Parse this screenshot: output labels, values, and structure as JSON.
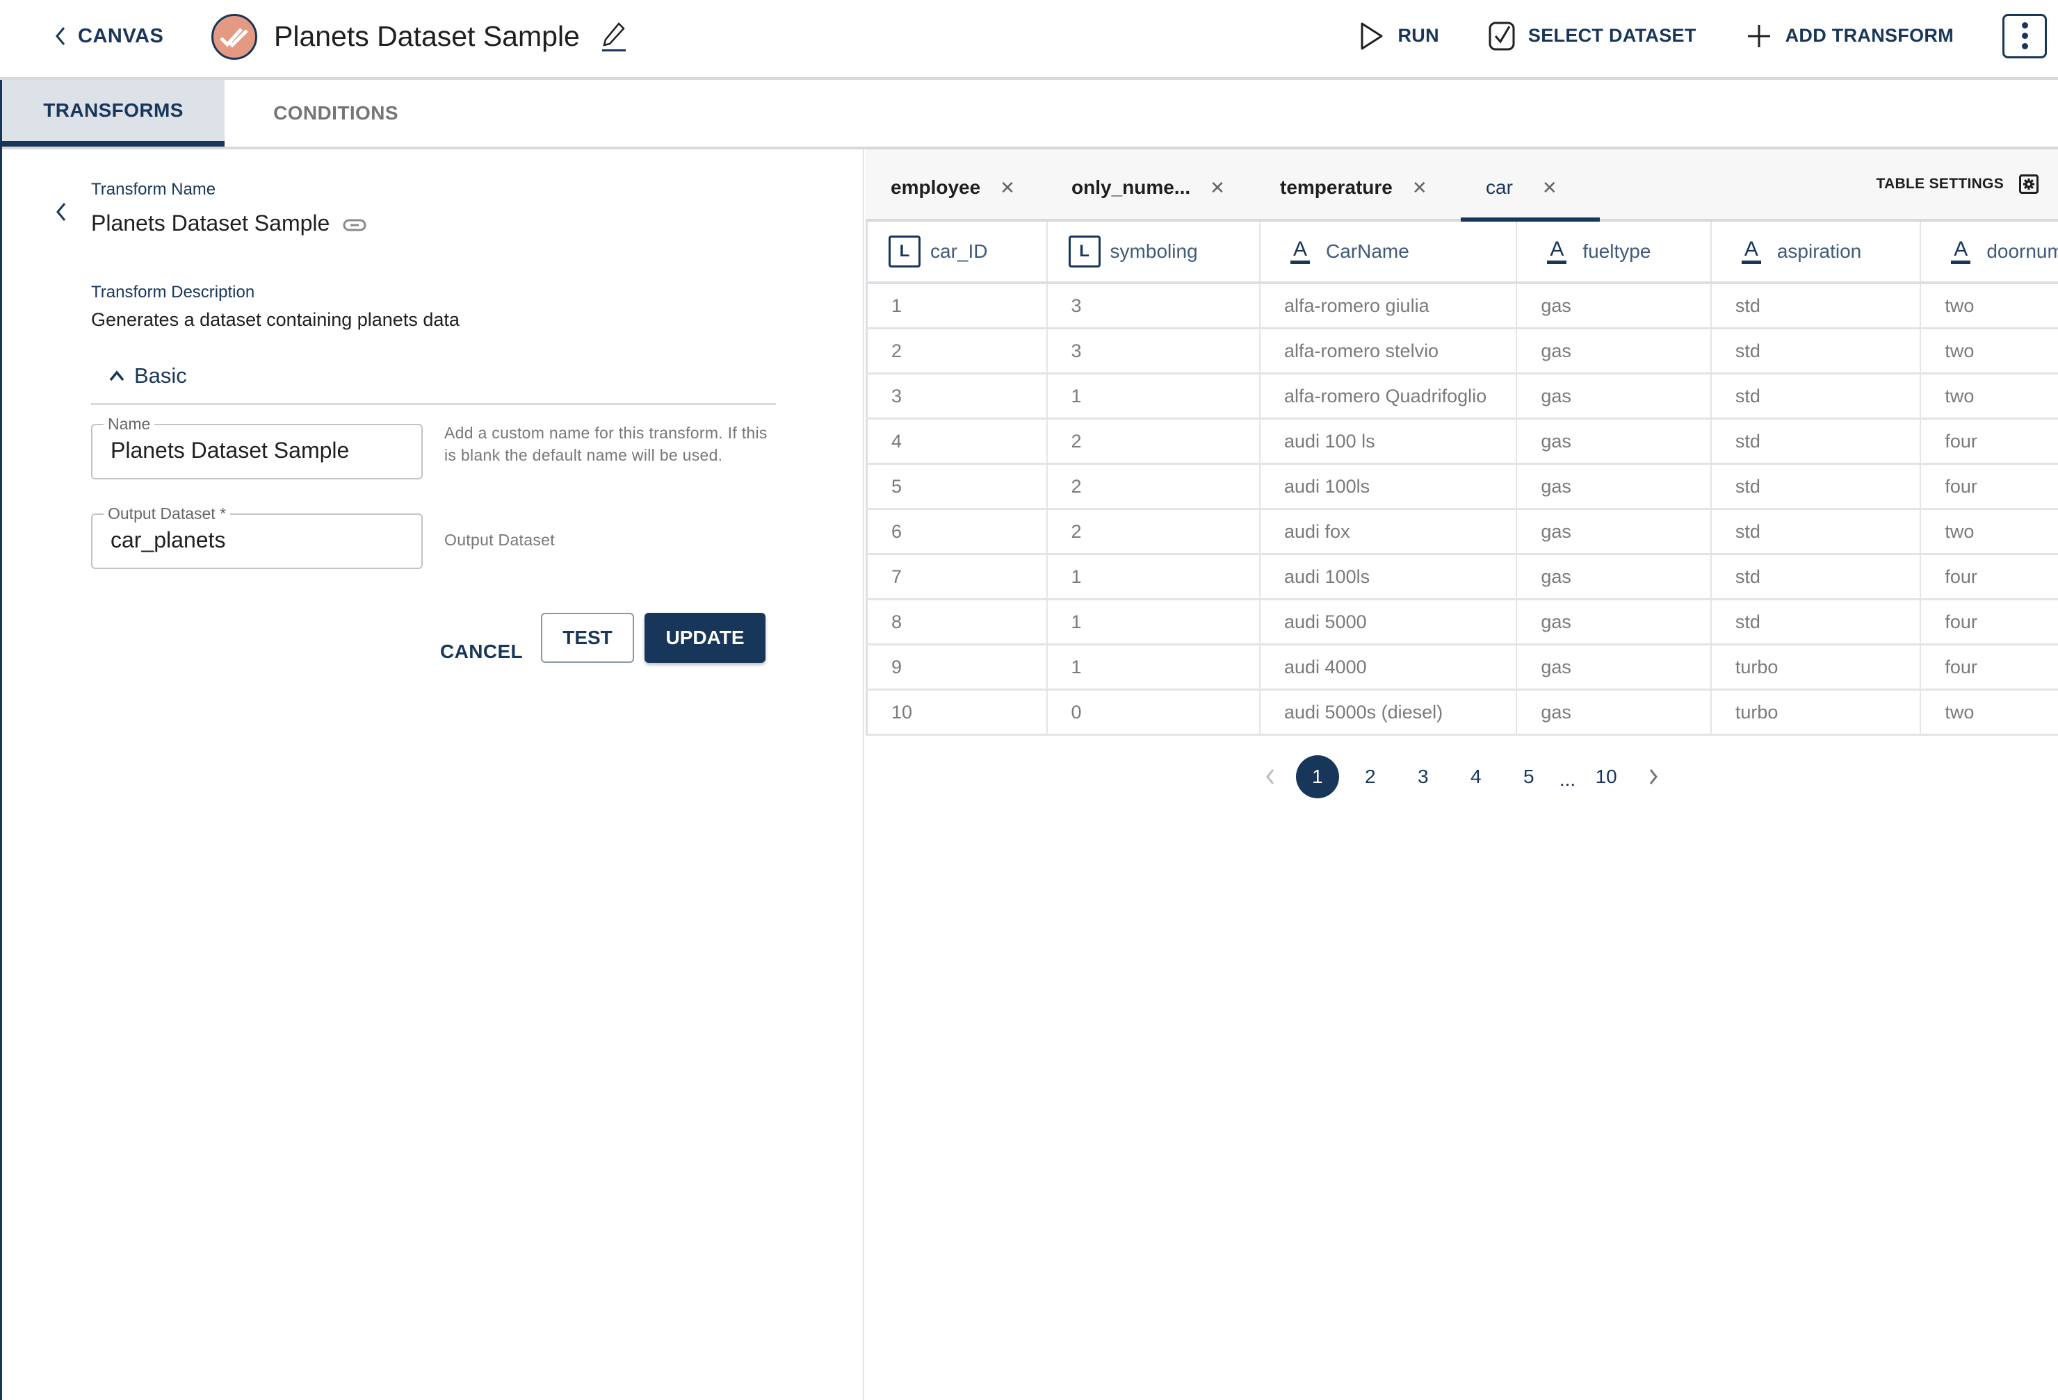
{
  "header": {
    "back_label": "CANVAS",
    "title": "Planets Dataset Sample",
    "badge_color": "#e49a82",
    "actions": [
      {
        "label": "RUN",
        "icon": "play-icon"
      },
      {
        "label": "SELECT DATASET",
        "icon": "checkbox-icon"
      },
      {
        "label": "ADD TRANSFORM",
        "icon": "plus-icon"
      }
    ],
    "more_icon": "kebab-icon"
  },
  "main_tabs": [
    {
      "label": "TRANSFORMS",
      "active": true
    },
    {
      "label": "CONDITIONS",
      "active": false
    }
  ],
  "transform": {
    "name_label": "Transform Name",
    "name_value": "Planets Dataset Sample",
    "description_label": "Transform Description",
    "description_value": "Generates a dataset containing planets data",
    "section_label": "Basic",
    "fields": {
      "name": {
        "label": "Name",
        "value": "Planets Dataset Sample",
        "helper": "Add a custom name for this transform. If this is blank the default name will be used."
      },
      "output_dataset": {
        "label": "Output Dataset *",
        "value": "car_planets",
        "helper": "Output Dataset"
      }
    },
    "buttons": {
      "cancel": "CANCEL",
      "test": "TEST",
      "update": "UPDATE"
    }
  },
  "dataset_tabs": [
    {
      "label": "employee",
      "active": false
    },
    {
      "label": "only_nume...",
      "active": false
    },
    {
      "label": "temperature",
      "active": false
    },
    {
      "label": "car",
      "active": true
    }
  ],
  "table_settings_label": "TABLE SETTINGS",
  "table": {
    "columns": [
      {
        "name": "car_ID",
        "type": "L"
      },
      {
        "name": "symboling",
        "type": "L"
      },
      {
        "name": "CarName",
        "type": "A"
      },
      {
        "name": "fueltype",
        "type": "A"
      },
      {
        "name": "aspiration",
        "type": "A"
      },
      {
        "name": "doornum",
        "type": "A"
      }
    ],
    "rows": [
      [
        "1",
        "3",
        "alfa-romero giulia",
        "gas",
        "std",
        "two"
      ],
      [
        "2",
        "3",
        "alfa-romero stelvio",
        "gas",
        "std",
        "two"
      ],
      [
        "3",
        "1",
        "alfa-romero Quadrifoglio",
        "gas",
        "std",
        "two"
      ],
      [
        "4",
        "2",
        "audi 100 ls",
        "gas",
        "std",
        "four"
      ],
      [
        "5",
        "2",
        "audi 100ls",
        "gas",
        "std",
        "four"
      ],
      [
        "6",
        "2",
        "audi fox",
        "gas",
        "std",
        "two"
      ],
      [
        "7",
        "1",
        "audi 100ls",
        "gas",
        "std",
        "four"
      ],
      [
        "8",
        "1",
        "audi 5000",
        "gas",
        "std",
        "four"
      ],
      [
        "9",
        "1",
        "audi 4000",
        "gas",
        "turbo",
        "four"
      ],
      [
        "10",
        "0",
        "audi 5000s (diesel)",
        "gas",
        "turbo",
        "two"
      ]
    ]
  },
  "pagination": {
    "current": "1",
    "pages": [
      "1",
      "2",
      "3",
      "4",
      "5"
    ],
    "ellipsis": "...",
    "last": "10"
  },
  "colors": {
    "primary": "#17365a",
    "badge": "#e49a82"
  }
}
